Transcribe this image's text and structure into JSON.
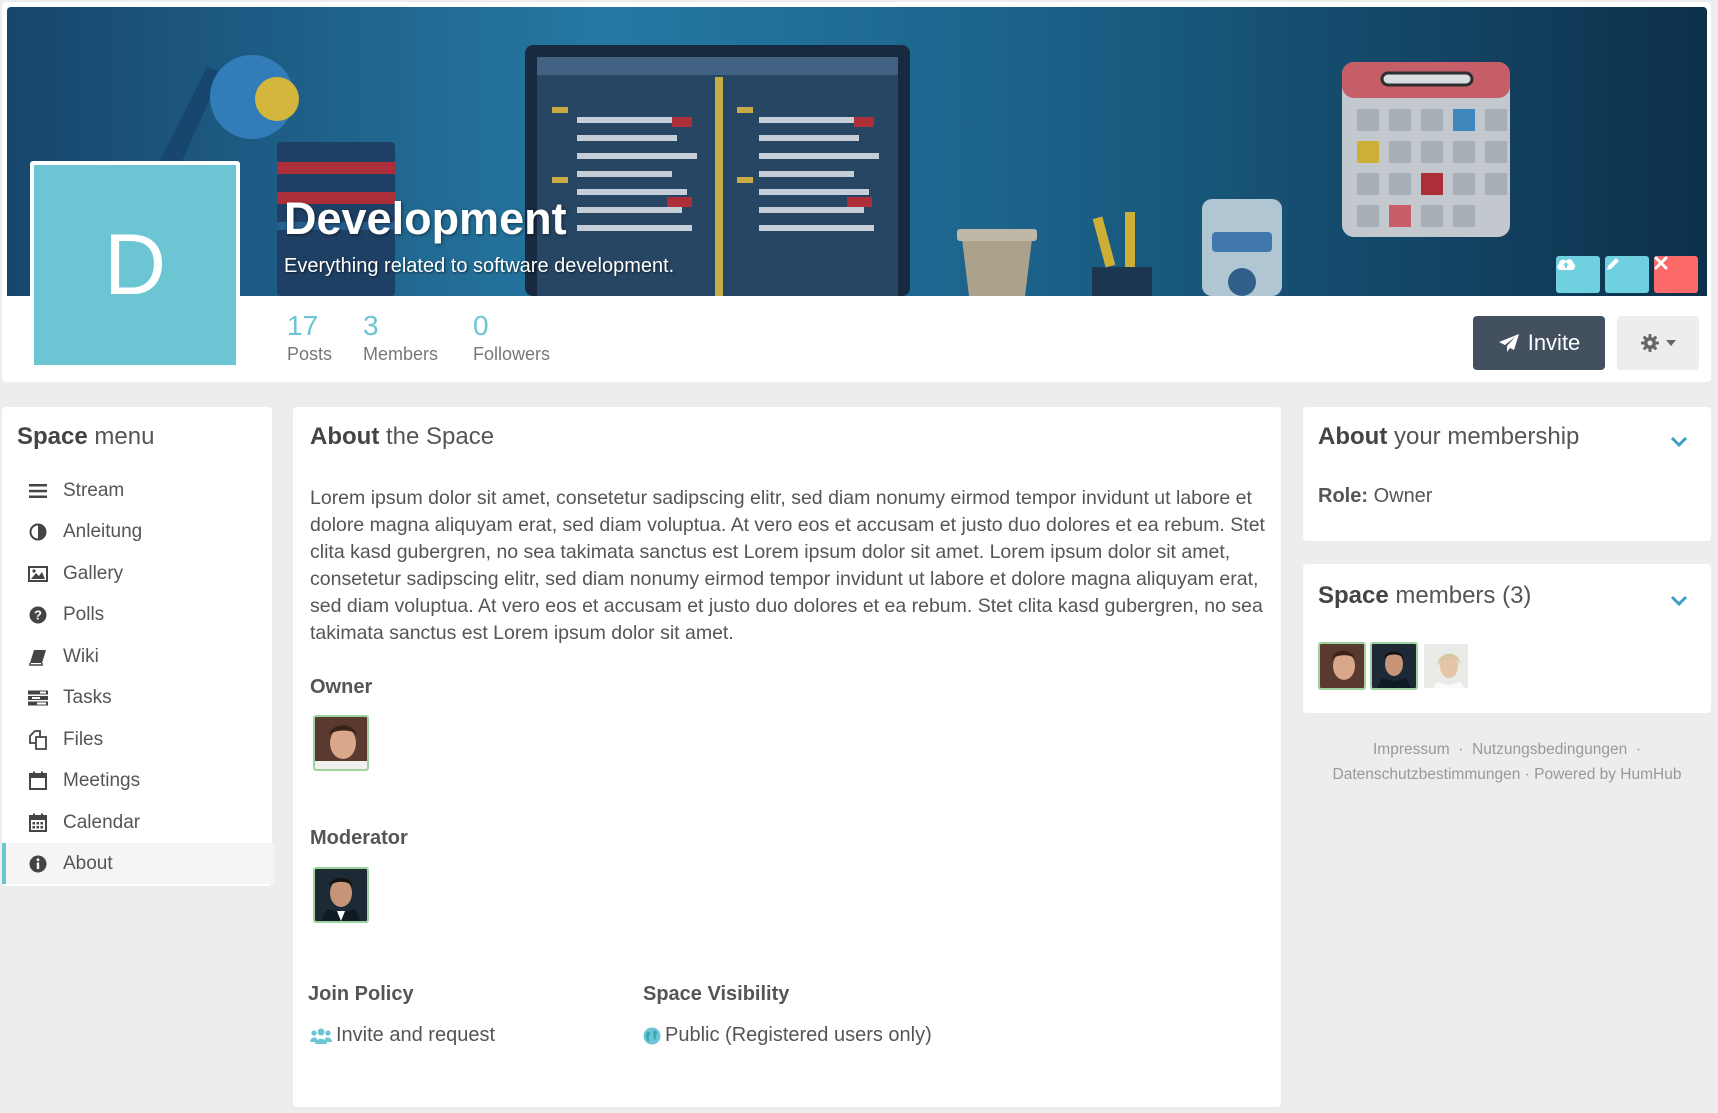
{
  "header": {
    "title": "Development",
    "description": "Everything related to software development.",
    "avatar_letter": "D",
    "avatar_color": "#6cc5d3",
    "stats": [
      {
        "value": "17",
        "label": "Posts"
      },
      {
        "value": "3",
        "label": "Members"
      },
      {
        "value": "0",
        "label": "Followers"
      }
    ],
    "invite_label": "Invite",
    "banner_buttons": [
      {
        "icon": "cloud-upload-icon",
        "color": "#6fd1e0"
      },
      {
        "icon": "pencil-icon",
        "color": "#6fd1e0"
      },
      {
        "icon": "close-icon",
        "color": "#fc6a6a"
      }
    ],
    "settings_icon": "gear-icon"
  },
  "space_menu": {
    "title_bold": "Space",
    "title_rest": "menu",
    "items": [
      {
        "label": "Stream",
        "icon": "bars-icon"
      },
      {
        "label": "Anleitung",
        "icon": "adjust-icon"
      },
      {
        "label": "Gallery",
        "icon": "image-icon"
      },
      {
        "label": "Polls",
        "icon": "question-circle-icon"
      },
      {
        "label": "Wiki",
        "icon": "book-icon"
      },
      {
        "label": "Tasks",
        "icon": "tasks-icon"
      },
      {
        "label": "Files",
        "icon": "files-icon"
      },
      {
        "label": "Meetings",
        "icon": "calendar-empty-icon"
      },
      {
        "label": "Calendar",
        "icon": "calendar-icon"
      },
      {
        "label": "About",
        "icon": "info-circle-icon",
        "active": true
      }
    ]
  },
  "about": {
    "title_bold": "About",
    "title_rest": "the Space",
    "text": "Lorem ipsum dolor sit amet, consetetur sadipscing elitr, sed diam nonumy eirmod tempor invidunt ut labore et dolore magna aliquyam erat, sed diam voluptua. At vero eos et accusam et justo duo dolores et ea rebum. Stet clita kasd gubergren, no sea takimata sanctus est Lorem ipsum dolor sit amet. Lorem ipsum dolor sit amet, consetetur sadipscing elitr, sed diam nonumy eirmod tempor invidunt ut labore et dolore magna aliquyam erat, sed diam voluptua. At vero eos et accusam et justo duo dolores et ea rebum. Stet clita kasd gubergren, no sea takimata sanctus est Lorem ipsum dolor sit amet.",
    "owner_label": "Owner",
    "moderator_label": "Moderator",
    "join_policy_label": "Join Policy",
    "join_policy_value": "Invite and request",
    "visibility_label": "Space Visibility",
    "visibility_value": "Public (Registered users only)"
  },
  "membership": {
    "title_bold": "About",
    "title_rest": "your membership",
    "role_label": "Role:",
    "role_value": "Owner"
  },
  "members": {
    "title_bold": "Space",
    "title_rest": "members (3)"
  },
  "footer": {
    "impressum": "Impressum",
    "nutzung": "Nutzungsbedingungen",
    "datenschutz": "Datenschutzbestimmungen",
    "powered": "Powered by HumHub",
    "separator": "·"
  }
}
